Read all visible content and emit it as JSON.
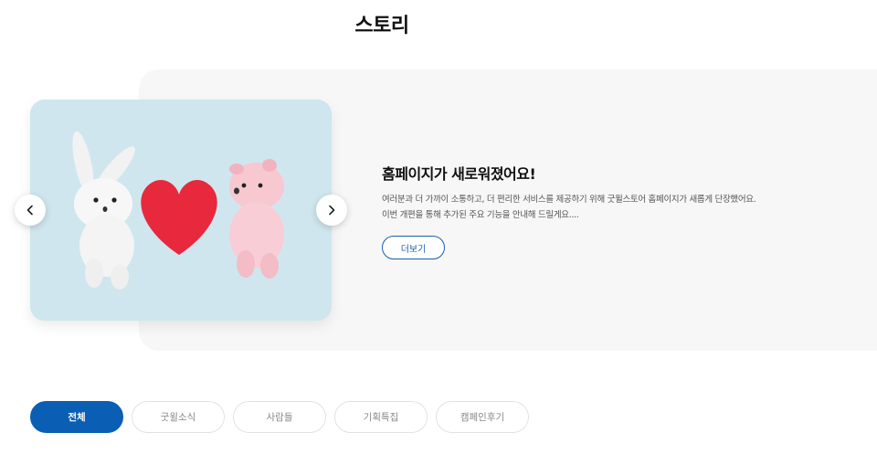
{
  "page": {
    "title": "스토리"
  },
  "hero": {
    "headline": "홈페이지가 새로워졌어요!",
    "description_lines": [
      "여러분과 더 가까이 소통하고, 더 편리한 서비스를 제공하기 위해 굿윌스토어 홈페이지가 새롭게 단장했어요.",
      "이번 개편을 통해 추가된 주요 기능을 안내해 드릴게요...."
    ],
    "more_label": "더보기",
    "image_icon": "bunny-pig-heart-illustration"
  },
  "carousel": {
    "prev_icon": "chevron-left-icon",
    "next_icon": "chevron-right-icon"
  },
  "filters": {
    "tabs": [
      {
        "label": "전체",
        "active": true
      },
      {
        "label": "굿윌소식",
        "active": false
      },
      {
        "label": "사람들",
        "active": false
      },
      {
        "label": "기획특집",
        "active": false
      },
      {
        "label": "캠페인후기",
        "active": false
      }
    ]
  },
  "colors": {
    "accent": "#0a5fb4",
    "panel_bg": "#f7f7f7",
    "image_bg": "#cfe6ef"
  }
}
